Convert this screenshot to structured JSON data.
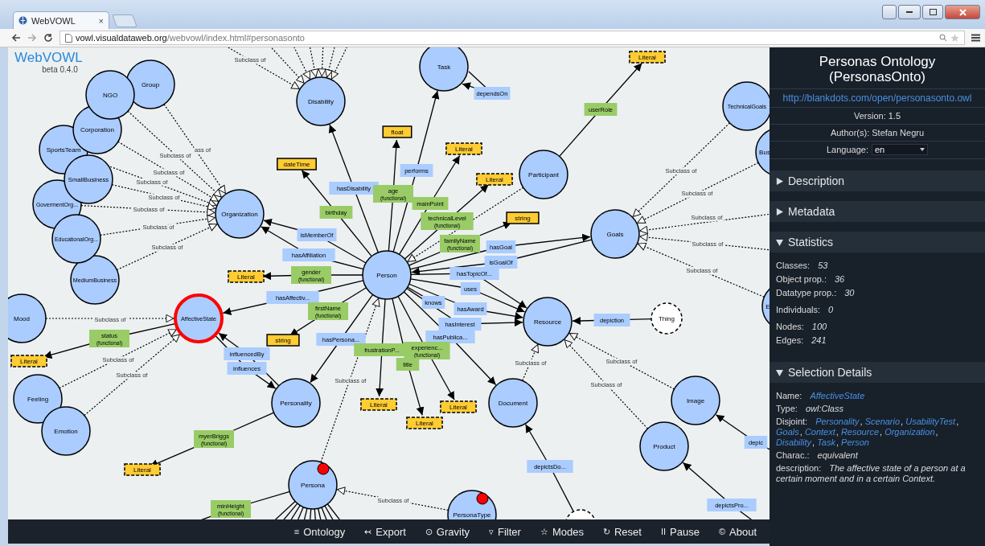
{
  "browser": {
    "tab_title": "WebVOWL",
    "tab_close": "×",
    "url_host": "vowl.visualdataweb.org",
    "url_path": "/webvowl/index.html#personasonto"
  },
  "app": {
    "logo": "WebVOWL",
    "version": "beta 0.4.0"
  },
  "graph": {
    "classes": [
      {
        "label": "Group",
        "kind": "class",
        "selected": false,
        "pinned": false
      },
      {
        "label": "NGO",
        "kind": "class",
        "selected": false,
        "pinned": false
      },
      {
        "label": "Corporation",
        "kind": "class",
        "selected": false,
        "pinned": false
      },
      {
        "label": "SportsTeam",
        "kind": "class",
        "selected": false,
        "pinned": false
      },
      {
        "label": "SmallBusiness",
        "kind": "class",
        "selected": false,
        "pinned": false
      },
      {
        "label": "GovermentOrg...",
        "kind": "class",
        "selected": false,
        "pinned": false
      },
      {
        "label": "EducationalOrg...",
        "kind": "class",
        "selected": false,
        "pinned": false
      },
      {
        "label": "MediumBusiness",
        "kind": "class",
        "selected": false,
        "pinned": false
      },
      {
        "label": "Disability",
        "kind": "class",
        "selected": false,
        "pinned": false
      },
      {
        "label": "Task",
        "kind": "class",
        "selected": false,
        "pinned": false
      },
      {
        "label": "Organization",
        "kind": "class",
        "selected": false,
        "pinned": false
      },
      {
        "label": "Person",
        "kind": "class",
        "selected": false,
        "pinned": false
      },
      {
        "label": "Participant",
        "kind": "class",
        "selected": false,
        "pinned": false
      },
      {
        "label": "Goals",
        "kind": "class",
        "selected": false,
        "pinned": false
      },
      {
        "label": "TechnicalGoals",
        "kind": "class",
        "selected": false,
        "pinned": false
      },
      {
        "label": "Bus",
        "kind": "class",
        "selected": false,
        "pinned": false
      },
      {
        "label": "Mood",
        "kind": "class",
        "selected": false,
        "pinned": false
      },
      {
        "label": "AffectiveState",
        "kind": "class",
        "selected": true,
        "pinned": false
      },
      {
        "label": "Resource",
        "kind": "class",
        "selected": false,
        "pinned": false
      },
      {
        "label": "Thing",
        "kind": "thing",
        "selected": false,
        "pinned": false
      },
      {
        "label": "Personality",
        "kind": "class",
        "selected": false,
        "pinned": false
      },
      {
        "label": "Feeling",
        "kind": "class",
        "selected": false,
        "pinned": false
      },
      {
        "label": "Emotion",
        "kind": "class",
        "selected": false,
        "pinned": false
      },
      {
        "label": "Document",
        "kind": "class",
        "selected": false,
        "pinned": false
      },
      {
        "label": "Image",
        "kind": "class",
        "selected": false,
        "pinned": false
      },
      {
        "label": "Product",
        "kind": "class",
        "selected": false,
        "pinned": false
      },
      {
        "label": "Persona",
        "kind": "class",
        "selected": false,
        "pinned": true
      },
      {
        "label": "PersonaType",
        "kind": "class",
        "selected": false,
        "pinned": true
      },
      {
        "kind": "thing",
        "selected": false,
        "pinned": false
      },
      {
        "label": "E",
        "kind": "class",
        "selected": false,
        "pinned": false
      }
    ],
    "datatypes": [
      {
        "label": "Literal",
        "kind": "literal"
      },
      {
        "label": "float",
        "kind": "datatype"
      },
      {
        "label": "Literal",
        "kind": "literal"
      },
      {
        "label": "dateTime",
        "kind": "datatype"
      },
      {
        "label": "Literal",
        "kind": "literal"
      },
      {
        "label": "string",
        "kind": "datatype"
      },
      {
        "label": "Literal",
        "kind": "literal"
      },
      {
        "label": "string",
        "kind": "datatype"
      },
      {
        "label": "Literal",
        "kind": "literal"
      },
      {
        "label": "Literal",
        "kind": "literal"
      },
      {
        "label": "Literal",
        "kind": "literal"
      },
      {
        "label": "Literal",
        "kind": "literal"
      },
      {
        "label": "Literal",
        "kind": "literal"
      }
    ],
    "properties": [
      {
        "label": "dependsOn",
        "kind": "object"
      },
      {
        "label": "userRole",
        "kind": "datatype"
      },
      {
        "label": "performs",
        "kind": "object"
      },
      {
        "label": "hasDisability",
        "kind": "object"
      },
      {
        "label": "age",
        "sublabel": "(functional)",
        "kind": "datatype"
      },
      {
        "label": "mainPoint",
        "kind": "datatype"
      },
      {
        "label": "birthday",
        "kind": "datatype"
      },
      {
        "label": "technicalLevel",
        "sublabel": "(functional)",
        "kind": "datatype"
      },
      {
        "label": "isMemberOf",
        "kind": "object"
      },
      {
        "label": "familyName",
        "sublabel": "(functional)",
        "kind": "datatype"
      },
      {
        "label": "hasGoal",
        "kind": "object"
      },
      {
        "label": "hasAffiliation",
        "kind": "object"
      },
      {
        "label": "isGoalOf",
        "kind": "object"
      },
      {
        "label": "hasTopicOf...",
        "kind": "object"
      },
      {
        "label": "gender",
        "sublabel": "(functional)",
        "kind": "datatype"
      },
      {
        "label": "uses",
        "kind": "object"
      },
      {
        "label": "hasAffectiv...",
        "kind": "object"
      },
      {
        "label": "knows",
        "kind": "object"
      },
      {
        "label": "hasAward",
        "kind": "object"
      },
      {
        "label": "firstName",
        "sublabel": "(functional)",
        "kind": "datatype"
      },
      {
        "label": "depiction",
        "kind": "object"
      },
      {
        "label": "hasInterest",
        "kind": "object"
      },
      {
        "label": "status",
        "sublabel": "(functional)",
        "kind": "datatype"
      },
      {
        "label": "hasPersona...",
        "kind": "object"
      },
      {
        "label": "hasPublica...",
        "kind": "object"
      },
      {
        "label": "influencedBy",
        "kind": "object"
      },
      {
        "label": "frustrationP...",
        "kind": "datatype"
      },
      {
        "label": "experienc...",
        "sublabel": "(functional)",
        "kind": "datatype"
      },
      {
        "label": "title",
        "kind": "datatype"
      },
      {
        "label": "influences",
        "kind": "object"
      },
      {
        "label": "myerBriggs",
        "sublabel": "(functional)",
        "kind": "datatype"
      },
      {
        "label": "depic",
        "kind": "object"
      },
      {
        "label": "depictsDo...",
        "kind": "object"
      },
      {
        "label": "depictsPro...",
        "kind": "object"
      },
      {
        "label": "minHeight",
        "sublabel": "(functional)",
        "kind": "datatype"
      }
    ],
    "subclass_labels": [
      "Subclass of",
      "ass of",
      "Subclass of",
      "Subclass of",
      "Subclass of",
      "Subclass of",
      "Subclass of",
      "Subclass of",
      "Subclass of",
      "Subclass of",
      "Subclass of",
      "Subclass of",
      "Subclass of",
      "Subclass of",
      "Subclass of",
      "Subclass of",
      "Subclass of",
      "Subclass of",
      "Subclass of",
      "Subclass of",
      "Subclass of",
      "Subclass of"
    ]
  },
  "menu": [
    {
      "icon": "≡",
      "label": "Ontology"
    },
    {
      "icon": "↢",
      "label": "Export"
    },
    {
      "icon": "⊙",
      "label": "Gravity"
    },
    {
      "icon": "▿",
      "label": "Filter"
    },
    {
      "icon": "☆",
      "label": "Modes"
    },
    {
      "icon": "↻",
      "label": "Reset"
    },
    {
      "icon": "II",
      "label": "Pause"
    },
    {
      "icon": "©",
      "label": "About"
    }
  ],
  "sidebar": {
    "title": "Personas Ontology (PersonasOnto)",
    "iri": "http://blankdots.com/open/personasonto.owl",
    "version": "Version: 1.5",
    "author": "Author(s): Stefan Negru",
    "language_label": "Language:",
    "language": "en",
    "sections": [
      {
        "title": "Description",
        "expanded": false
      },
      {
        "title": "Metadata",
        "expanded": false
      },
      {
        "title": "Statistics",
        "expanded": true,
        "groups": [
          [
            {
              "label": "Classes:",
              "value": "53"
            },
            {
              "label": "Object prop.:",
              "value": "36"
            },
            {
              "label": "Datatype prop.:",
              "value": "30"
            }
          ],
          [
            {
              "label": "Individuals:",
              "value": "0"
            }
          ],
          [
            {
              "label": "Nodes:",
              "value": "100"
            },
            {
              "label": "Edges:",
              "value": "241"
            }
          ]
        ]
      },
      {
        "title": "Selection Details",
        "expanded": true,
        "details": [
          {
            "label": "Name:",
            "kind": "link",
            "value": "AffectiveState"
          },
          {
            "label": "Type:",
            "kind": "text",
            "value": "owl:Class"
          },
          {
            "label": "Disjoint:",
            "kind": "links",
            "separator": ", ",
            "values": [
              "Personality",
              "Scenario",
              "UsabilityTest",
              "Goals",
              "Context",
              "Resource",
              "Organization",
              "Disability",
              "Task",
              "Person"
            ]
          },
          {
            "label": "Charac.:",
            "kind": "text",
            "value": "equivalent"
          },
          {
            "label": "description:",
            "kind": "text",
            "value": "The affective state of a person at a certain moment and in a certain Context."
          }
        ]
      }
    ]
  }
}
